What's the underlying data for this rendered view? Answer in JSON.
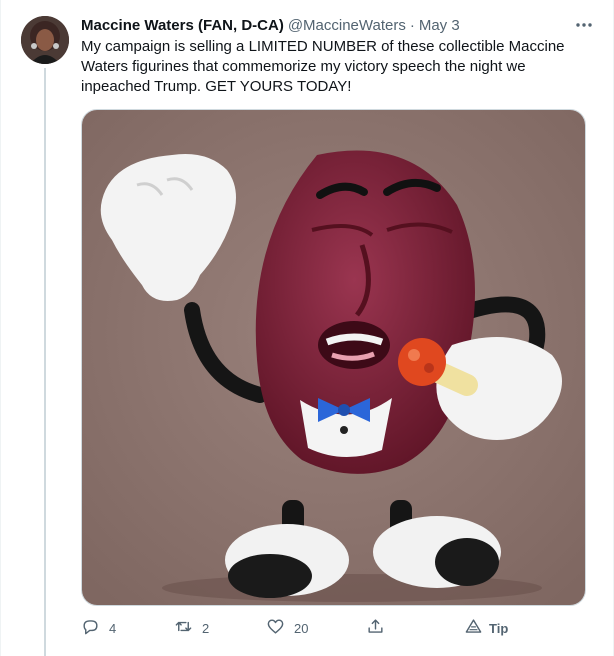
{
  "author": {
    "name": "Maccine Waters (FAN, D-CA)",
    "handle": "@MaccineWaters",
    "separator": "·",
    "date": "May 3"
  },
  "tweet": {
    "text": "My campaign is selling a LIMITED NUMBER of these collectible Maccine Waters figurines that commemorize my victory speech the night we inpeached Trump. GET YOURS TODAY!"
  },
  "actions": {
    "reply_count": "4",
    "retweet_count": "2",
    "like_count": "20",
    "tip_label": "Tip"
  },
  "icons": {
    "more": "more-horizontal-icon",
    "reply": "reply-icon",
    "retweet": "retweet-icon",
    "like": "heart-icon",
    "share": "share-icon",
    "tip": "tip-icon"
  },
  "colors": {
    "text_primary": "#0f1419",
    "text_secondary": "#536471",
    "thread_line": "#cfd9de",
    "media_background": "#8e7670",
    "figurine_body": "#7a1f36"
  }
}
